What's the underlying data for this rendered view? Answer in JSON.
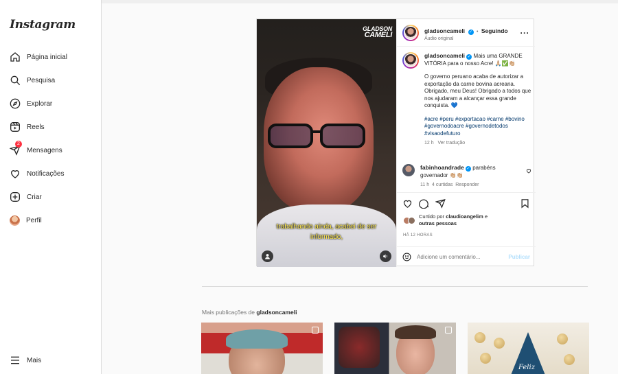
{
  "sidebar": {
    "logo": "Instagram",
    "items": [
      {
        "label": "Página inicial",
        "icon": "home-icon"
      },
      {
        "label": "Pesquisa",
        "icon": "search-icon"
      },
      {
        "label": "Explorar",
        "icon": "compass-icon"
      },
      {
        "label": "Reels",
        "icon": "reels-icon"
      },
      {
        "label": "Mensagens",
        "icon": "messenger-icon",
        "badge": "2"
      },
      {
        "label": "Notificações",
        "icon": "heart-icon"
      },
      {
        "label": "Criar",
        "icon": "plus-square-icon"
      },
      {
        "label": "Perfil",
        "icon": "profile-avatar"
      }
    ],
    "more": "Mais"
  },
  "post": {
    "username": "gladsoncameli",
    "separator": "•",
    "follow_status": "Seguindo",
    "audio": "Áudio original",
    "video": {
      "brand_line1": "GLADSON",
      "brand_line2": "CAMELI",
      "subtitle_line1": "trabalhando ainda, acabei de ser",
      "subtitle_line2": "informado,"
    },
    "caption": {
      "username": "gladsoncameli",
      "text1": "Mais uma GRANDE VITÓRIA para o nosso Acre! 🙏🏼✅👏🏼",
      "text2": "O governo peruano acaba de autorizar a exportação da carne bovina acreana. Obrigado, meu Deus! Obrigado a todos que nos ajudaram a alcançar essa grande conquista. 💙",
      "hashtags": "#acre #peru #exportacao #carne #bovino #governodoacre #governodetodos #visaodefuturo",
      "time": "12 h",
      "translate": "Ver tradução"
    },
    "comment": {
      "username": "fabinhoandrade",
      "text": "parabéns governador 👏🏼👏🏼",
      "time": "11 h",
      "likes": "4 curtidas",
      "reply": "Responder"
    },
    "liked_by_prefix": "Curtido por",
    "liked_by_user": "claudioangelim",
    "liked_by_suffix": "e",
    "liked_by_others": "outras pessoas",
    "posted_ago": "HÁ 12 HORAS",
    "comment_placeholder": "Adicione um comentário...",
    "publish": "Publicar"
  },
  "more_posts": {
    "prefix": "Mais publicações de",
    "username": "gladsoncameli",
    "thumb3_text": "Feliz"
  },
  "colors": {
    "accent": "#0095f6",
    "badge": "#ff3040",
    "hashtag": "#00376b",
    "subtitle": "#ffe94f"
  }
}
